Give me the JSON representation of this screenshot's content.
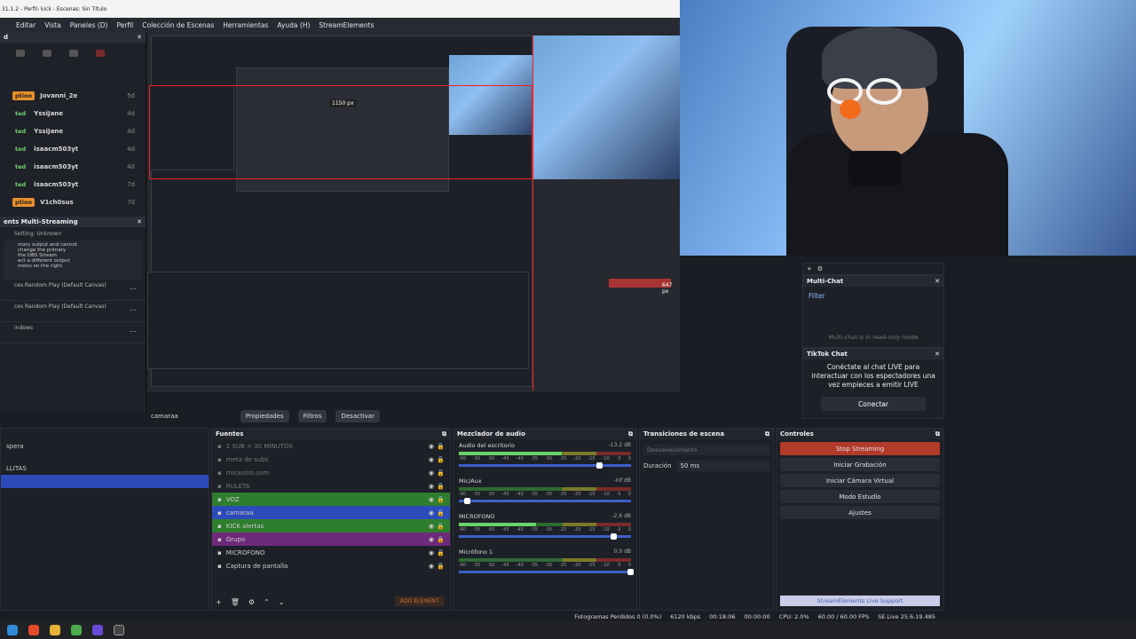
{
  "window": {
    "title": "31.1.2 - Perfil: kick - Escenas: Sin Título"
  },
  "menu": [
    "Editar",
    "Vista",
    "Paneles (D)",
    "Perfil",
    "Colección de Escenas",
    "Herramientas",
    "Ayuda (H)",
    "StreamElements"
  ],
  "activity": {
    "rows": [
      {
        "badge": "ption",
        "name": "Jovanni_2e",
        "time": "5d"
      },
      {
        "badge": "ted",
        "name": "YssiJane",
        "time": "4d"
      },
      {
        "badge": "ted",
        "name": "YssiJane",
        "time": "4d"
      },
      {
        "badge": "ted",
        "name": "isaacm503yt",
        "time": "4d"
      },
      {
        "badge": "ted",
        "name": "isaacm503yt",
        "time": "4d"
      },
      {
        "badge": "ted",
        "name": "isaacm503yt",
        "time": "7d"
      },
      {
        "badge": "ption",
        "name": "V1ch0sus",
        "time": "7d"
      }
    ]
  },
  "multistream": {
    "title": "ents Multi-Streaming",
    "setting": "Setting: Unknown",
    "note": "mary output and cannot\n change the primary\n the OBS Stream\nect a different output\nmenu on the right.",
    "rows": [
      "ces Random Play (Default Canvas)",
      "ces Random Play (Default Canvas)",
      "indows"
    ]
  },
  "preview_overlay": {
    "width_label": "1150 px",
    "height_label": "647 px"
  },
  "multichat": {
    "title": "Multi-Chat",
    "filter": "Filter",
    "readonly": "Multi-chat is in read-only mode"
  },
  "tiktok": {
    "title": "TikTok Chat",
    "message": "Conéctate al chat LIVE para interactuar con los espectadores una vez empieces a emitir LIVE",
    "button": "Conectar"
  },
  "context": {
    "source": "camaraa",
    "properties": "Propiedades",
    "filters": "Filtros",
    "deactivate": "Desactivar"
  },
  "scenes": {
    "items": [
      "spera",
      "LLITAS",
      ""
    ]
  },
  "sources": {
    "title": "Fuentes",
    "items": [
      {
        "name": "1 SUB = 30 MINUTOS",
        "dim": true
      },
      {
        "name": "meta de subs",
        "dim": true
      },
      {
        "name": "micasino.com",
        "dim": true
      },
      {
        "name": "RULETA",
        "dim": true
      },
      {
        "name": "VOZ",
        "dim": false,
        "color": "#2f7d2f"
      },
      {
        "name": "camaraa",
        "dim": false,
        "color": "#2c4bb8"
      },
      {
        "name": "KICK alertas",
        "dim": false,
        "color": "#2f7d2f"
      },
      {
        "name": "Grupo",
        "dim": false,
        "color": "#6d2a7a"
      },
      {
        "name": "MICROFONO",
        "dim": false
      },
      {
        "name": "Captura de pantalla",
        "dim": false
      }
    ],
    "add_label": "ADD ELEMENT"
  },
  "mixer": {
    "title": "Mezclador de audio",
    "channels": [
      {
        "name": "Audio del escritorio",
        "db": "-13.2 dB",
        "level": 0.6,
        "volume": 0.82
      },
      {
        "name": "Mic/Aux",
        "db": "-inf dB",
        "level": 0.0,
        "volume": 0.05
      },
      {
        "name": "MICROFONO",
        "db": "-2.6 dB",
        "level": 0.45,
        "volume": 0.9
      },
      {
        "name": "Micrófono 1",
        "db": "0.0 dB",
        "level": 0.0,
        "volume": 1.0
      }
    ],
    "ticks": [
      "-60",
      "-55",
      "-50",
      "-45",
      "-40",
      "-35",
      "-30",
      "-25",
      "-20",
      "-15",
      "-10",
      "-5",
      "0"
    ]
  },
  "transitions": {
    "title": "Transiciones de escena",
    "selected": "Desvanecimiento",
    "duration_label": "Duración",
    "duration": "50 ms"
  },
  "controls": {
    "title": "Controles",
    "buttons": [
      "Stop Streaming",
      "Iniciar Grabación",
      "Iniciar Cámara Virtual",
      "Modo Estudio",
      "Ajustes"
    ],
    "support": "StreamElements Live Support"
  },
  "status": {
    "dropped": "Fotogramas Perdidos 0 (0.0%)",
    "bitrate": "6120 kbps",
    "live": "00:18:06",
    "rec": "00:00:00",
    "cpu": "CPU: 2.0%",
    "fps": "60.00 / 60.00 FPS",
    "version": "SE.Live 25.6.19.485"
  },
  "colors": {
    "stop": "#b23a2a",
    "accent": "#2c4bb8",
    "green": "#2f7d2f",
    "purple": "#6d2a7a"
  }
}
